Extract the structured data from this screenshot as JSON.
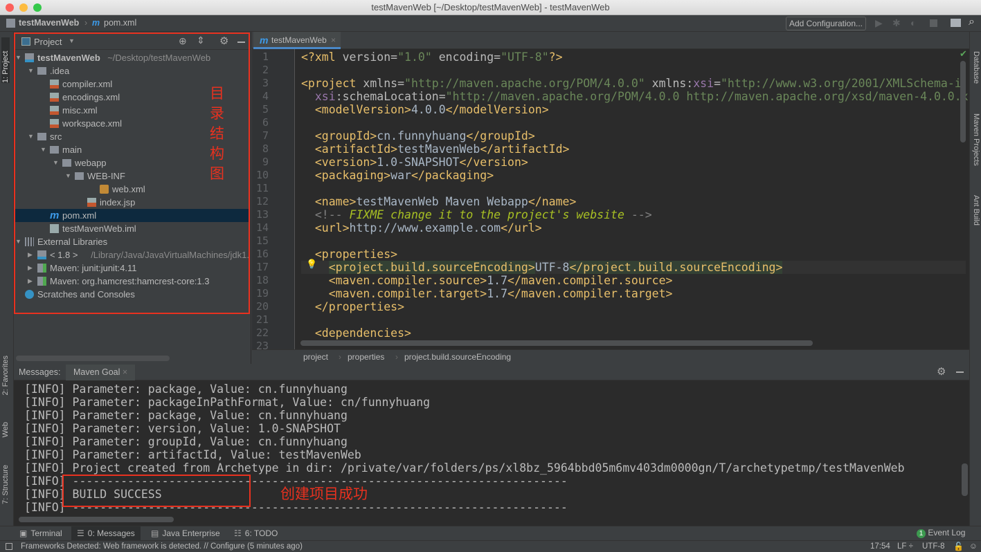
{
  "window": {
    "title": "testMavenWeb [~/Desktop/testMavenWeb] - testMavenWeb"
  },
  "navbar": {
    "crumbs": [
      "testMavenWeb",
      "pom.xml"
    ],
    "add_configuration": "Add Configuration..."
  },
  "left_tool_tabs": [
    "1: Project",
    "2: Favorites",
    "Web",
    "7: Structure"
  ],
  "right_tool_tabs": [
    "Database",
    "Maven Projects",
    "Ant Build"
  ],
  "project_panel": {
    "title": "Project",
    "tree": [
      {
        "label": "testMavenWeb",
        "hint": "~/Desktop/testMavenWeb",
        "depth": 0,
        "arrow": "down",
        "icon": "module-folder",
        "bold": true
      },
      {
        "label": ".idea",
        "depth": 1,
        "arrow": "down",
        "icon": "folder"
      },
      {
        "label": "compiler.xml",
        "depth": 2,
        "icon": "xml-file"
      },
      {
        "label": "encodings.xml",
        "depth": 2,
        "icon": "xml-file"
      },
      {
        "label": "misc.xml",
        "depth": 2,
        "icon": "xml-file"
      },
      {
        "label": "workspace.xml",
        "depth": 2,
        "icon": "xml-file"
      },
      {
        "label": "src",
        "depth": 1,
        "arrow": "down",
        "icon": "folder"
      },
      {
        "label": "main",
        "depth": 2,
        "arrow": "down",
        "icon": "folder"
      },
      {
        "label": "webapp",
        "depth": 3,
        "arrow": "down",
        "icon": "folder"
      },
      {
        "label": "WEB-INF",
        "depth": 4,
        "arrow": "down",
        "icon": "folder"
      },
      {
        "label": "web.xml",
        "depth": 6,
        "icon": "web-xml-file"
      },
      {
        "label": "index.jsp",
        "depth": 5,
        "icon": "jsp-file"
      },
      {
        "label": "pom.xml",
        "depth": 2,
        "icon": "maven-file",
        "selected": true
      },
      {
        "label": "testMavenWeb.iml",
        "depth": 2,
        "icon": "iml-file"
      },
      {
        "label": "External Libraries",
        "depth": 0,
        "arrow": "down",
        "icon": "libraries"
      },
      {
        "label": "< 1.8 >",
        "hint": "/Library/Java/JavaVirtualMachines/jdk1.",
        "depth": 1,
        "arrow": "right",
        "icon": "jdk-folder"
      },
      {
        "label": "Maven: junit:junit:4.11",
        "depth": 1,
        "arrow": "right",
        "icon": "library"
      },
      {
        "label": "Maven: org.hamcrest:hamcrest-core:1.3",
        "depth": 1,
        "arrow": "right",
        "icon": "library"
      },
      {
        "label": "Scratches and Consoles",
        "depth": 0,
        "icon": "scratches"
      }
    ]
  },
  "annotations": {
    "tree_label": "目录结构图",
    "build_label": "创建项目成功",
    "color": "#e8311f"
  },
  "editor": {
    "tab": "testMavenWeb",
    "lines": [
      [
        [
          "tag",
          "<?xml "
        ],
        [
          "attr",
          "version="
        ],
        [
          "str",
          "\"1.0\""
        ],
        [
          "attr",
          " encoding="
        ],
        [
          "str",
          "\"UTF-8\""
        ],
        [
          "tag",
          "?>"
        ]
      ],
      [],
      [
        [
          "tag",
          "<project "
        ],
        [
          "attr",
          "xmlns="
        ],
        [
          "str",
          "\"http://maven.apache.org/POM/4.0.0\""
        ],
        [
          "attr",
          " xmlns:"
        ],
        [
          "ns",
          "xsi"
        ],
        [
          "attr",
          "="
        ],
        [
          "str",
          "\"http://www.w3.org/2001/XMLSchema-i"
        ]
      ],
      [
        [
          "txt",
          "  "
        ],
        [
          "ns",
          "xsi"
        ],
        [
          "attr",
          ":schemaLocation="
        ],
        [
          "str",
          "\"http://maven.apache.org/POM/4.0.0 http://maven.apache.org/xsd/maven-4.0.0.x"
        ]
      ],
      [
        [
          "txt",
          "  "
        ],
        [
          "tag",
          "<modelVersion>"
        ],
        [
          "txt",
          "4.0.0"
        ],
        [
          "tag",
          "</modelVersion>"
        ]
      ],
      [],
      [
        [
          "txt",
          "  "
        ],
        [
          "tag",
          "<groupId>"
        ],
        [
          "txt",
          "cn.funnyhuang"
        ],
        [
          "tag",
          "</groupId>"
        ]
      ],
      [
        [
          "txt",
          "  "
        ],
        [
          "tag",
          "<artifactId>"
        ],
        [
          "txt",
          "testMavenWeb"
        ],
        [
          "tag",
          "</artifactId>"
        ]
      ],
      [
        [
          "txt",
          "  "
        ],
        [
          "tag",
          "<version>"
        ],
        [
          "txt",
          "1.0-SNAPSHOT"
        ],
        [
          "tag",
          "</version>"
        ]
      ],
      [
        [
          "txt",
          "  "
        ],
        [
          "tag",
          "<packaging>"
        ],
        [
          "txt",
          "war"
        ],
        [
          "tag",
          "</packaging>"
        ]
      ],
      [],
      [
        [
          "txt",
          "  "
        ],
        [
          "tag",
          "<name>"
        ],
        [
          "txt",
          "testMavenWeb Maven Webapp"
        ],
        [
          "tag",
          "</name>"
        ]
      ],
      [
        [
          "txt",
          "  "
        ],
        [
          "cmt",
          "<!-- "
        ],
        [
          "todo",
          "FIXME change it to the project's website"
        ],
        [
          "cmt",
          " -->"
        ]
      ],
      [
        [
          "txt",
          "  "
        ],
        [
          "tag",
          "<url>"
        ],
        [
          "txt",
          "http://www.example.com"
        ],
        [
          "tag",
          "</url>"
        ]
      ],
      [],
      [
        [
          "txt",
          "  "
        ],
        [
          "tag",
          "<properties>"
        ]
      ],
      [
        [
          "txt",
          "    "
        ],
        [
          "tag hl",
          "<project.build.sourceEncoding>"
        ],
        [
          "txt",
          "UTF-8"
        ],
        [
          "tag hl",
          "</project.build.sourceEncoding>"
        ]
      ],
      [
        [
          "txt",
          "    "
        ],
        [
          "tag",
          "<maven.compiler.source>"
        ],
        [
          "txt",
          "1.7"
        ],
        [
          "tag",
          "</maven.compiler.source>"
        ]
      ],
      [
        [
          "txt",
          "    "
        ],
        [
          "tag",
          "<maven.compiler.target>"
        ],
        [
          "txt",
          "1.7"
        ],
        [
          "tag",
          "</maven.compiler.target>"
        ]
      ],
      [
        [
          "txt",
          "  "
        ],
        [
          "tag",
          "</properties>"
        ]
      ],
      [],
      [
        [
          "txt",
          "  "
        ],
        [
          "tag",
          "<dependencies>"
        ]
      ],
      []
    ],
    "breadcrumb": [
      "project",
      "properties",
      "project.build.sourceEncoding"
    ]
  },
  "messages": {
    "label": "Messages:",
    "tab": "Maven Goal",
    "lines": [
      "[INFO] Parameter: package, Value: cn.funnyhuang",
      "[INFO] Parameter: packageInPathFormat, Value: cn/funnyhuang",
      "[INFO] Parameter: package, Value: cn.funnyhuang",
      "[INFO] Parameter: version, Value: 1.0-SNAPSHOT",
      "[INFO] Parameter: groupId, Value: cn.funnyhuang",
      "[INFO] Parameter: artifactId, Value: testMavenWeb",
      "[INFO] Project created from Archetype in dir: /private/var/folders/ps/xl8bz_5964bbd05m6mv403dm0000gn/T/archetypetmp/testMavenWeb",
      "[INFO] ------------------------------------------------------------------------",
      "[INFO] BUILD SUCCESS",
      "[INFO] ------------------------------------------------------------------------"
    ]
  },
  "bottom_tabs": [
    {
      "label": "Terminal",
      "icon": "terminal-icon"
    },
    {
      "label": "0: Messages",
      "icon": "messages-icon",
      "active": true
    },
    {
      "label": "Java Enterprise",
      "icon": "java-enterprise-icon"
    },
    {
      "label": "6: TODO",
      "icon": "todo-icon"
    }
  ],
  "event_log": {
    "count": "1",
    "label": "Event Log"
  },
  "status": {
    "message": "Frameworks Detected: Web framework is detected. // Configure (5 minutes ago)",
    "position": "17:54",
    "line_separator": "LF ÷",
    "encoding": "UTF-8"
  }
}
